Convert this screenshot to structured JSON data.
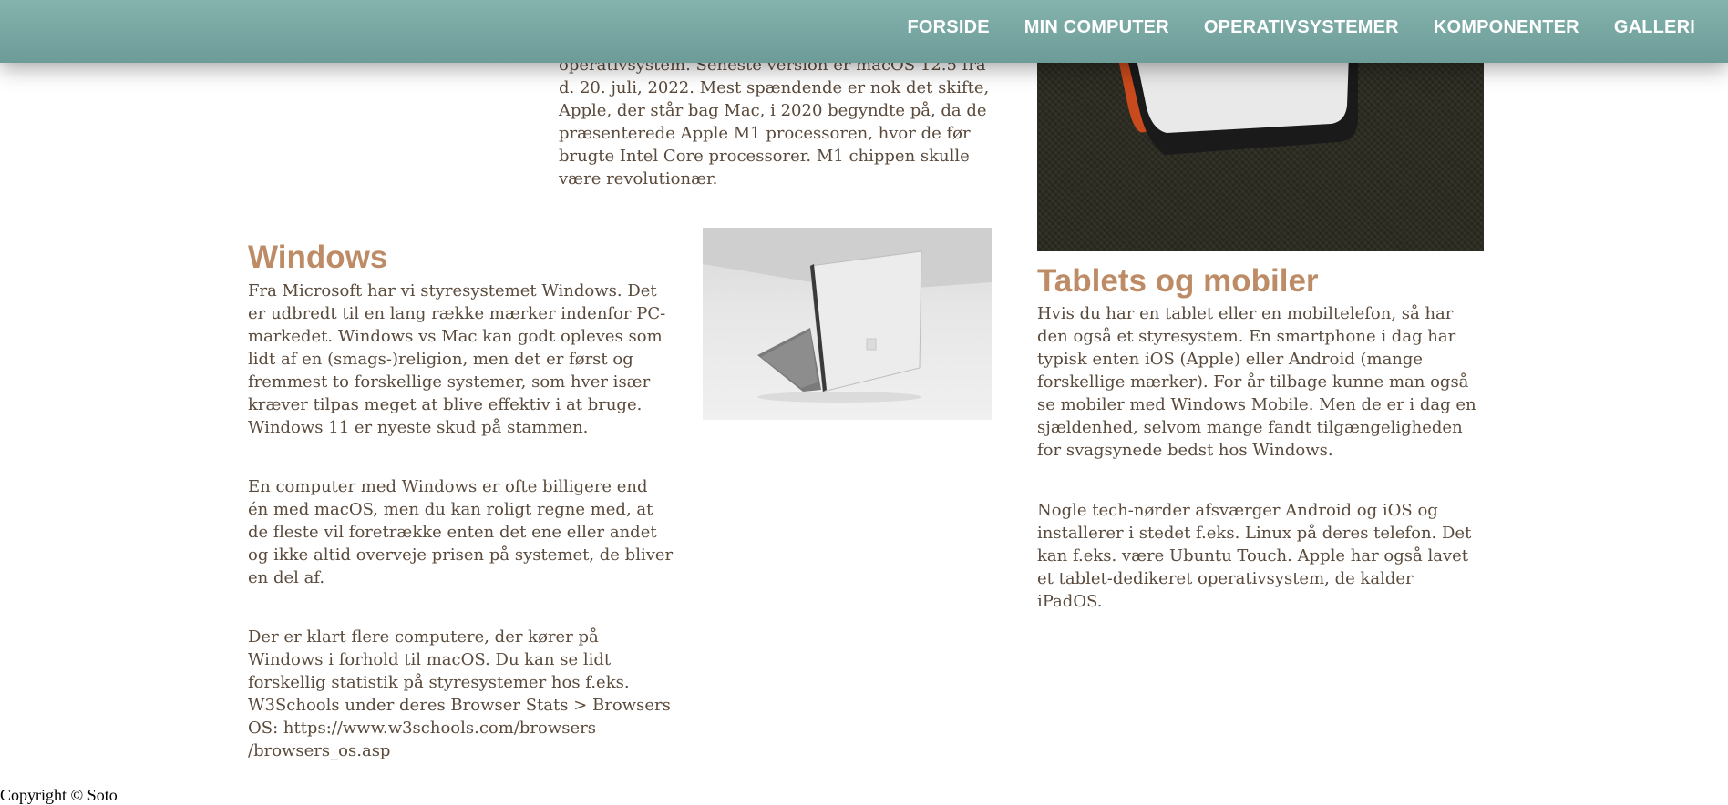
{
  "nav": {
    "items": [
      "FORSIDE",
      "MIN COMPUTER",
      "OPERATIVSYSTEMER",
      "KOMPONENTER",
      "GALLERI"
    ]
  },
  "mac": {
    "text_lines": [
      "operativsystem. Seneste version er macOS 12.5 fra",
      "d. 20. juli, 2022. Mest spændende er nok det skifte,",
      "Apple, der står bag Mac, i 2020 begyndte på, da de",
      "præsenterede Apple M1 processoren, hvor de før",
      "brugte Intel Core processorer. M1 chippen skulle",
      "være revolutionær."
    ]
  },
  "windows": {
    "heading": "Windows",
    "paragraphs": [
      [
        "Fra Microsoft har vi styresystemet Windows. Det",
        "er udbredt til en lang række mærker indenfor PC-",
        "markedet. Windows vs Mac kan godt opleves som",
        "lidt af en (smags-)religion, men det er først og",
        "fremmest to forskellige systemer, som hver især",
        "kræver tilpas meget at blive effektiv i at bruge.",
        "Windows 11 er nyeste skud på stammen."
      ],
      [
        "En computer med Windows er ofte billigere end",
        "én med macOS, men du kan roligt regne med, at",
        "de fleste vil foretrække enten det ene eller andet",
        "og ikke altid overveje prisen på systemet, de bliver",
        "en del af."
      ],
      [
        "Der er klart flere computere, der kører på",
        "Windows i forhold til macOS. Du kan se lidt",
        "forskellig statistik på styresystemer hos f.eks.",
        "W3Schools under deres Browser Stats > Browsers",
        "OS: https://www.w3schools.com/browsers",
        "/browsers_os.asp"
      ]
    ]
  },
  "tablets": {
    "heading": "Tablets og mobiler",
    "paragraphs": [
      [
        "Hvis du har en tablet eller en mobiltelefon, så har",
        "den også et styresystem. En smartphone i dag har",
        "typisk enten iOS (Apple) eller Android (mange",
        "forskellige mærker). For år tilbage kunne man også",
        "se mobiler med Windows Mobile. Men de er i dag en",
        "sjældenhed, selvom mange fandt tilgængeligheden",
        "for svagsynede bedst hos Windows."
      ],
      [
        "Nogle tech-nørder afsværger Android og iOS og",
        "installerer i stedet f.eks. Linux på deres telefon. Det",
        "kan f.eks. være Ubuntu Touch. Apple har også lavet",
        "et tablet-dedikeret operativsystem, de kalder",
        "iPadOS."
      ]
    ]
  },
  "footer": {
    "text": "Copyright © Soto"
  }
}
